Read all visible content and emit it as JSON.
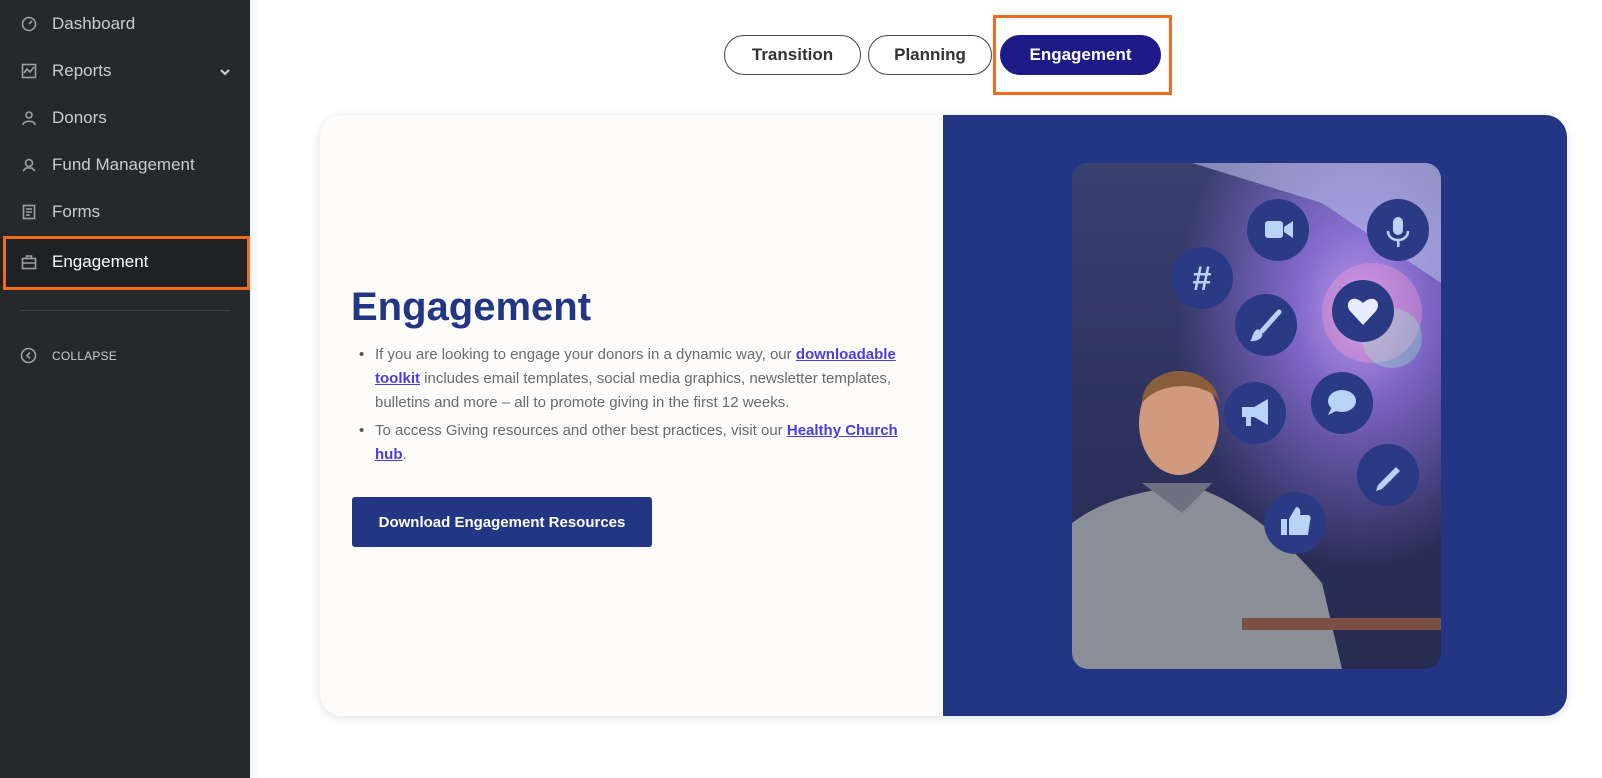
{
  "sidebar": {
    "items": [
      {
        "label": "Dashboard",
        "icon": "dashboard-icon"
      },
      {
        "label": "Reports",
        "icon": "reports-icon"
      },
      {
        "label": "Donors",
        "icon": "user-icon"
      },
      {
        "label": "Fund Management",
        "icon": "fund-icon"
      },
      {
        "label": "Forms",
        "icon": "forms-icon"
      },
      {
        "label": "Engagement",
        "icon": "briefcase-icon"
      }
    ],
    "active": "Engagement",
    "collapse_label": "COLLAPSE"
  },
  "tabs": {
    "items": [
      {
        "label": "Transition"
      },
      {
        "label": "Planning"
      },
      {
        "label": "Engagement"
      }
    ],
    "active": "Engagement"
  },
  "hero": {
    "title": "Engagement",
    "bullet1_before": "If you are looking to engage your donors in a dynamic way, our ",
    "bullet1_link": "downloadable toolkit",
    "bullet1_after": " includes email templates, social media graphics, newsletter templates, bulletins and more – all to promote giving in the first 12 weeks.",
    "bullet2_before": "To access Giving resources and other best practices, visit our ",
    "bullet2_link": "Healthy Church hub",
    "bullet2_after": ".",
    "button_label": "Download Engagement Resources"
  },
  "colors": {
    "accent": "#223683",
    "tab_active": "#1f1a8a",
    "highlight_outline": "#f26a1b",
    "sidebar_bg": "#25292b",
    "link": "#4b3de3"
  }
}
